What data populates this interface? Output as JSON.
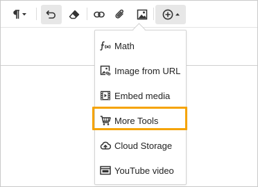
{
  "toolbar": {
    "buttons": [
      {
        "icon": "paragraph-icon",
        "has_dropdown": true
      },
      {
        "icon": "undo-icon",
        "active": true
      },
      {
        "icon": "eraser-icon"
      },
      {
        "icon": "link-icon"
      },
      {
        "icon": "paperclip-icon"
      },
      {
        "icon": "image-icon"
      },
      {
        "icon": "insert-plus-icon",
        "has_dropdown": true,
        "active": true
      }
    ]
  },
  "dropdown": {
    "items": [
      {
        "label": "Math",
        "icon": "math-function-icon"
      },
      {
        "label": "Image from URL",
        "icon": "image-url-icon"
      },
      {
        "label": "Embed media",
        "icon": "film-icon"
      },
      {
        "label": "More Tools",
        "icon": "cart-icon",
        "highlighted": true
      },
      {
        "label": "Cloud Storage",
        "icon": "cloud-upload-icon"
      },
      {
        "label": "YouTube video",
        "icon": "video-player-icon"
      }
    ]
  },
  "colors": {
    "highlight": "#f5a300",
    "icon": "#333333",
    "active_button_bg": "#e7e7e7"
  }
}
